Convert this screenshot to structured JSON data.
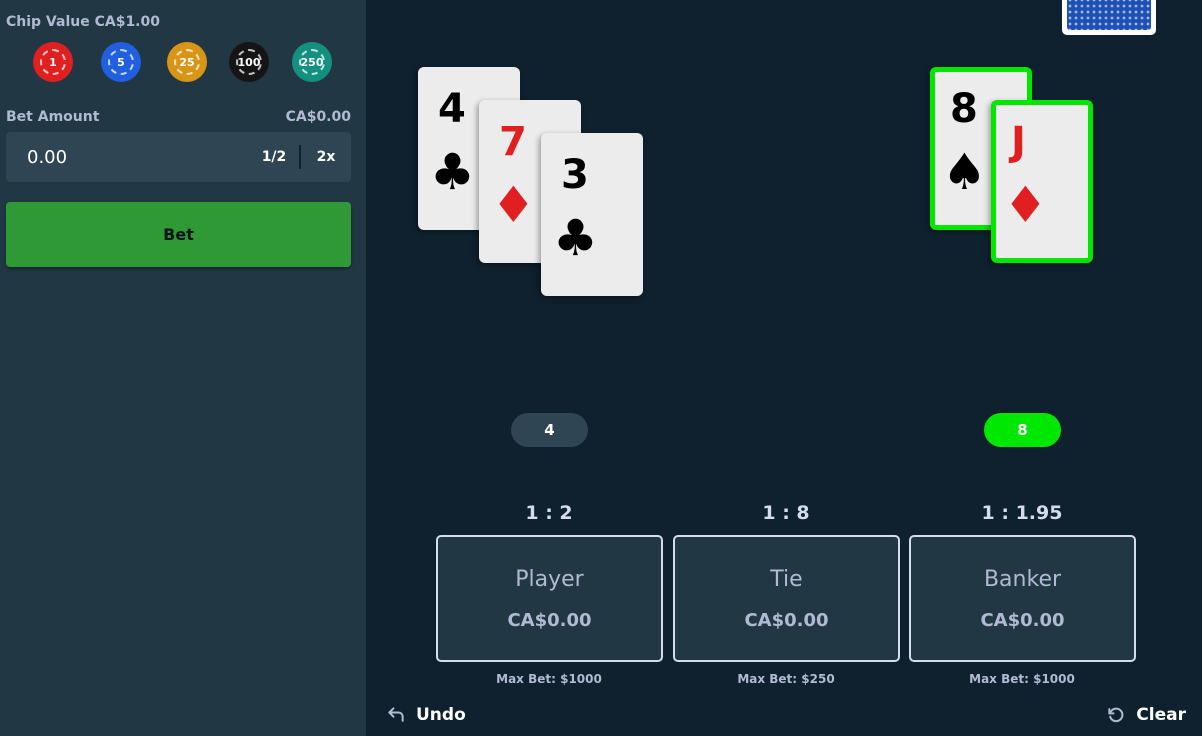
{
  "sidebar": {
    "chip_label": "Chip Value CA$1.00",
    "chips": [
      {
        "label": "1",
        "color": "#e02020"
      },
      {
        "label": "5",
        "color": "#1f5fe0"
      },
      {
        "label": "25",
        "color": "#d89516"
      },
      {
        "label": "100",
        "color": "#151515"
      },
      {
        "label": "250",
        "color": "#13907f"
      }
    ],
    "bet_label": "Bet Amount",
    "bet_value": "CA$0.00",
    "bet_input": "0.00",
    "half_label": "1/2",
    "double_label": "2x",
    "bet_button": "Bet"
  },
  "player": {
    "cards": [
      {
        "rank": "4",
        "suit": "♣",
        "color": "black",
        "suit_name": "club-icon"
      },
      {
        "rank": "7",
        "suit": "♦",
        "color": "red",
        "suit_name": "diamond-icon"
      },
      {
        "rank": "3",
        "suit": "♣",
        "color": "black",
        "suit_name": "club-icon"
      }
    ],
    "score": "4"
  },
  "banker": {
    "cards": [
      {
        "rank": "8",
        "suit": "♠",
        "color": "black",
        "suit_name": "spade-icon"
      },
      {
        "rank": "J",
        "suit": "♦",
        "color": "red",
        "suit_name": "diamond-icon"
      }
    ],
    "score": "8",
    "winner": true
  },
  "bets": [
    {
      "payout": "1 : 2",
      "name": "Player",
      "amount": "CA$0.00",
      "max": "Max Bet: $1000"
    },
    {
      "payout": "1 : 8",
      "name": "Tie",
      "amount": "CA$0.00",
      "max": "Max Bet: $250"
    },
    {
      "payout": "1 : 1.95",
      "name": "Banker",
      "amount": "CA$0.00",
      "max": "Max Bet: $1000"
    }
  ],
  "controls": {
    "undo": "Undo",
    "clear": "Clear"
  },
  "colors": {
    "win": "#00e701",
    "bet_button": "#2f9a35",
    "background": "#0f212e",
    "sidebar": "#213743"
  }
}
